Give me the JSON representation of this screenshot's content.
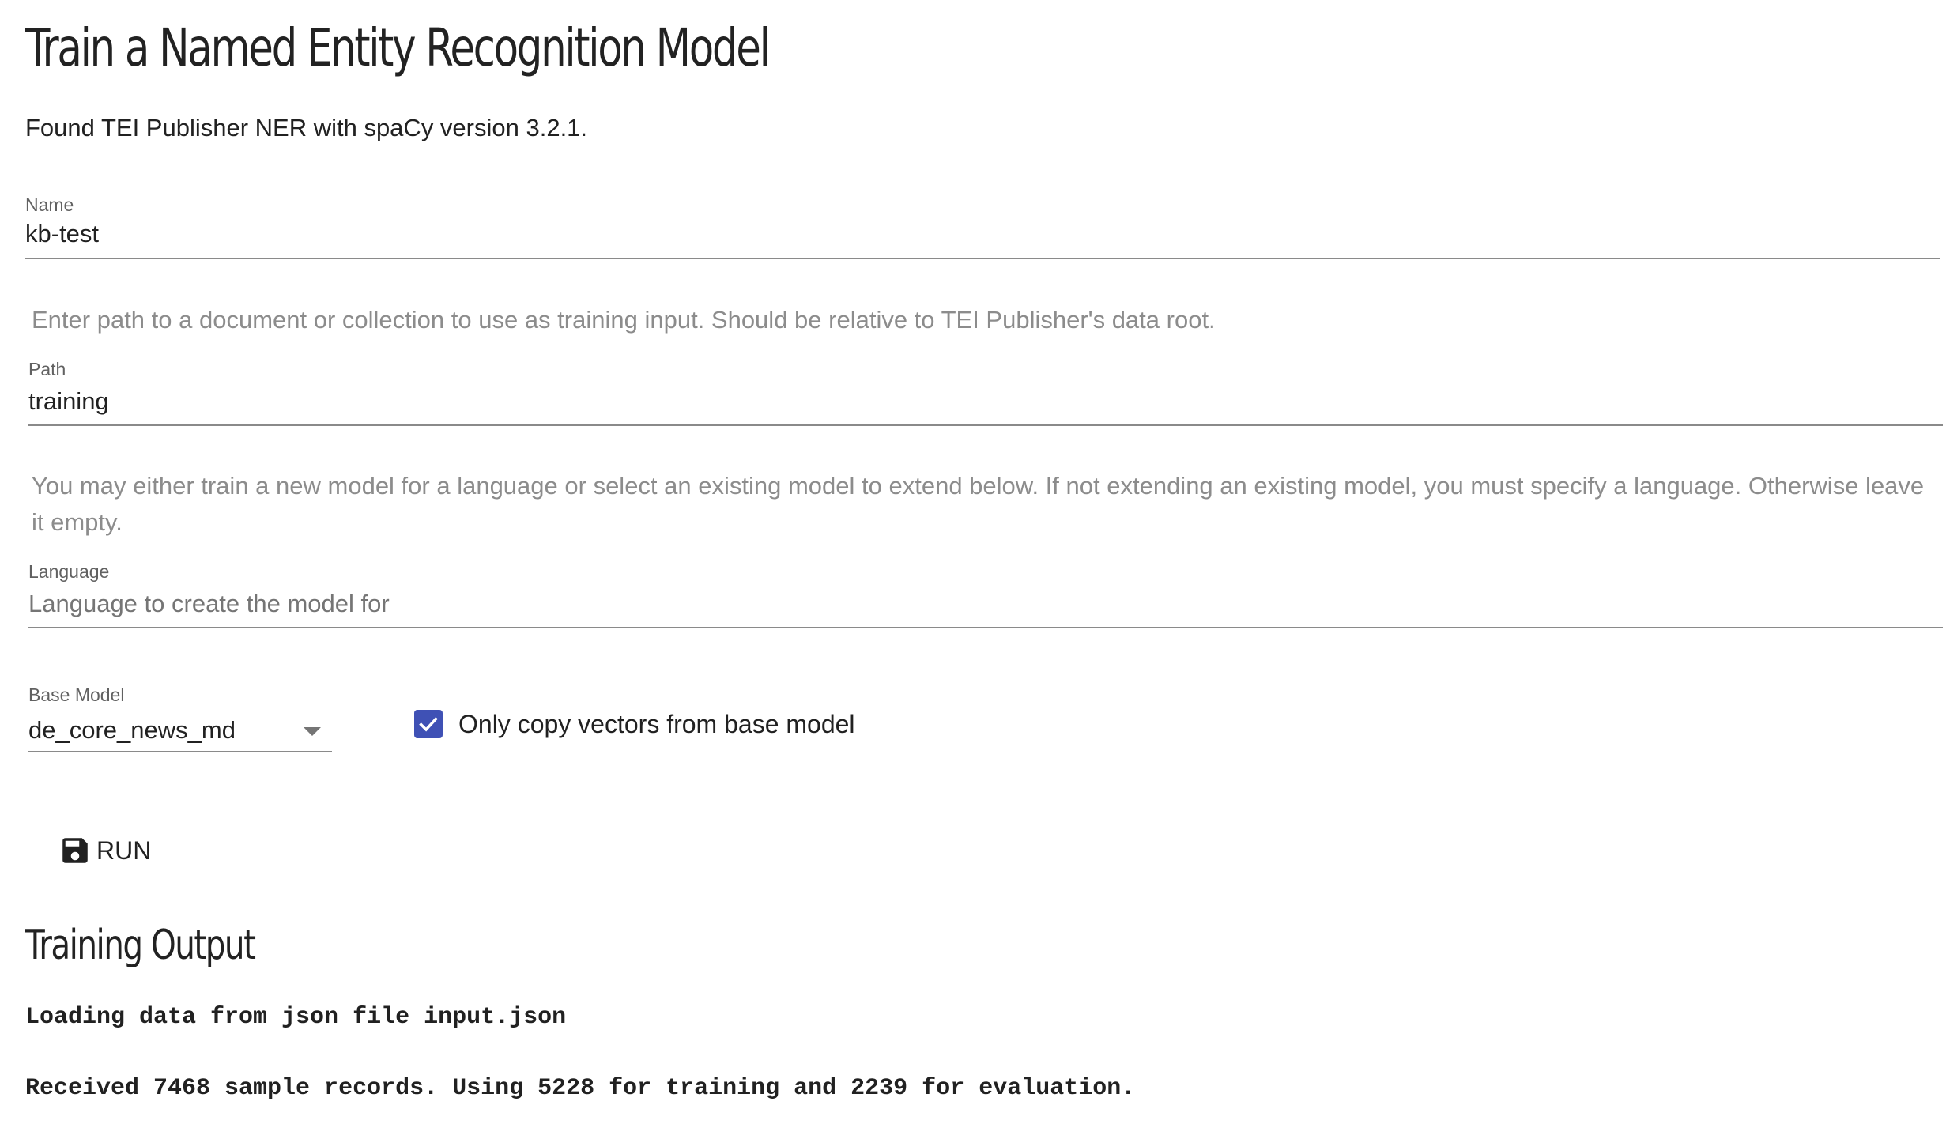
{
  "page": {
    "title": "Train a Named Entity Recognition Model",
    "status": "Found TEI Publisher NER with spaCy version 3.2.1."
  },
  "form": {
    "name": {
      "label": "Name",
      "value": "kb-test"
    },
    "path_help": "Enter path to a document or collection to use as training input. Should be relative to TEI Publisher's data root.",
    "path": {
      "label": "Path",
      "value": "training"
    },
    "language_help": "You may either train a new model for a language or select an existing model to extend below. If not extending an existing model, you must specify a language. Otherwise leave it empty.",
    "language": {
      "label": "Language",
      "placeholder": "Language to create the model for",
      "value": ""
    },
    "base_model": {
      "label": "Base Model",
      "selected": "de_core_news_md",
      "icon": "dropdown-arrow-icon"
    },
    "copy_vectors": {
      "label": "Only copy vectors from base model",
      "checked": true,
      "color": "#3f51b5"
    },
    "run_button": {
      "label": "RUN",
      "icon": "save-icon"
    }
  },
  "output": {
    "title": "Training Output",
    "lines": [
      "Loading data from json file input.json",
      "Received 7468 sample records. Using 5228 for training and 2239 for evaluation."
    ]
  }
}
